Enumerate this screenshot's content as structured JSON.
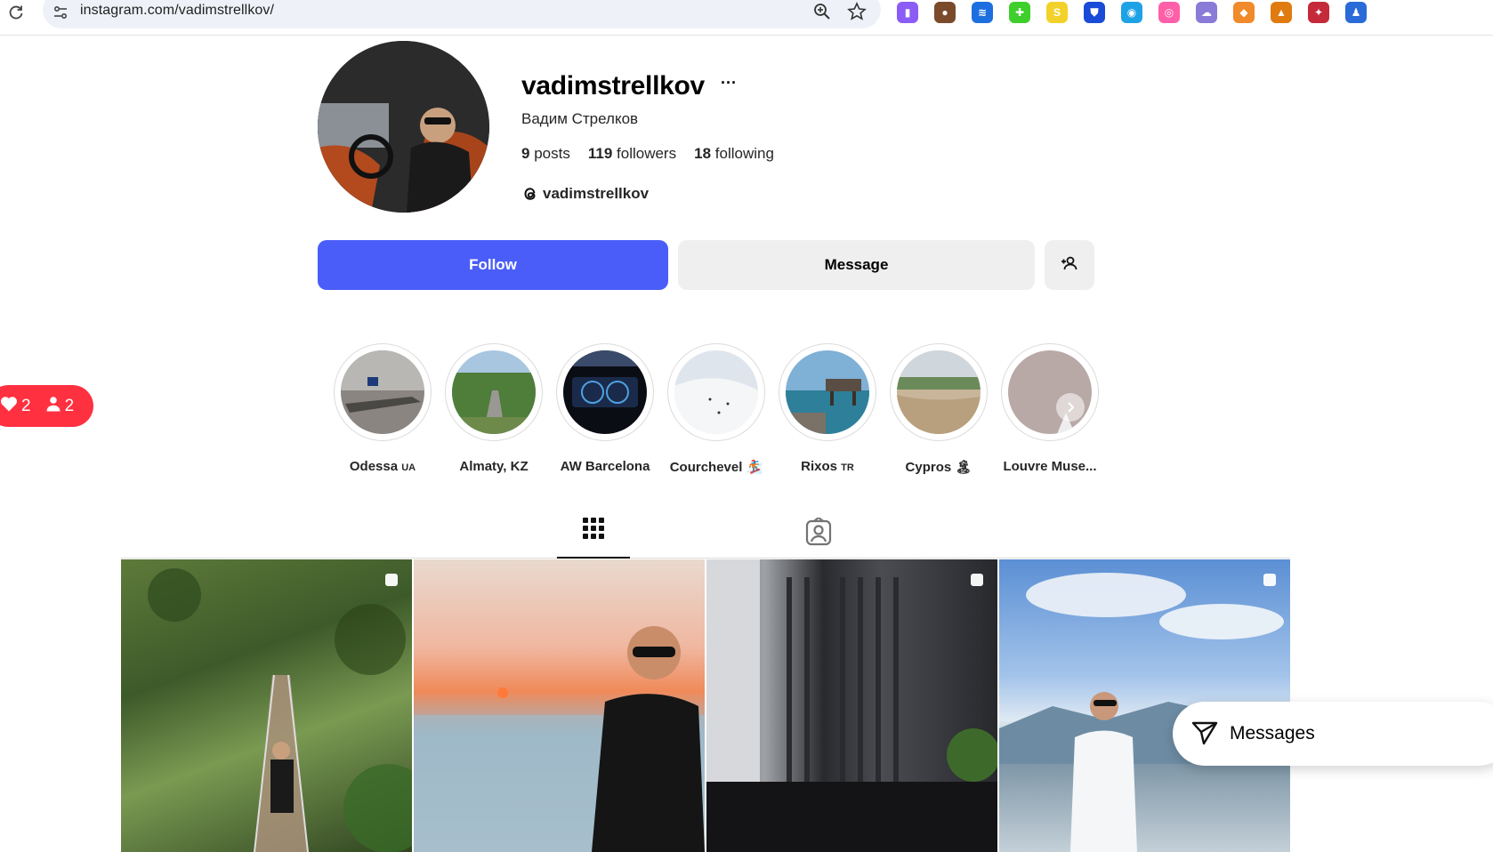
{
  "browser": {
    "url": "instagram.com/vadimstrellkov/",
    "extensions": [
      {
        "name": "purple-book-ext-icon",
        "color": "#8b5cf6",
        "glyph": "▮"
      },
      {
        "name": "cookie-ext-icon",
        "color": "#7a4a2a",
        "glyph": "●"
      },
      {
        "name": "layers-ext-icon",
        "color": "#1d6fe0",
        "glyph": "≋"
      },
      {
        "name": "green-grid-ext-icon",
        "color": "#3ecf2c",
        "glyph": "✚"
      },
      {
        "name": "yellow-s-ext-icon",
        "color": "#f2d22a",
        "glyph": "S"
      },
      {
        "name": "shield-ext-icon",
        "color": "#1a4bd8",
        "glyph": "⛊"
      },
      {
        "name": "blue-swirl-ext-icon",
        "color": "#1ea2e6",
        "glyph": "◉"
      },
      {
        "name": "pink-ext-icon",
        "color": "#ff5fa8",
        "glyph": "◎"
      },
      {
        "name": "purple-cloud-ext-icon",
        "color": "#8a7bd8",
        "glyph": "☁"
      },
      {
        "name": "fox-ext-icon",
        "color": "#f08a2a",
        "glyph": "◆"
      },
      {
        "name": "flame-ext-icon",
        "color": "#e07b10",
        "glyph": "▲"
      },
      {
        "name": "globe-ext-icon",
        "color": "#c52a3a",
        "glyph": "✦"
      },
      {
        "name": "puzzle-ext-icon",
        "color": "#2a6bd8",
        "glyph": "♟"
      }
    ]
  },
  "profile": {
    "username": "vadimstrellkov",
    "full_name": "Вадим Стрелков",
    "posts_count": "9",
    "posts_label": "posts",
    "followers_count": "119",
    "followers_label": "followers",
    "following_count": "18",
    "following_label": "following",
    "threads_handle": "vadimstrellkov"
  },
  "actions": {
    "follow_label": "Follow",
    "message_label": "Message"
  },
  "notifications": {
    "likes": "2",
    "follows": "2"
  },
  "highlights": [
    {
      "label": "Odessa",
      "flag": "UA"
    },
    {
      "label": "Almaty, KZ",
      "flag": ""
    },
    {
      "label": "AW Barcelona",
      "flag": ""
    },
    {
      "label": "Courchevel",
      "flag": "🏂"
    },
    {
      "label": "Rixos",
      "flag": "TR"
    },
    {
      "label": "Cypros",
      "flag": "🏝"
    },
    {
      "label": "Louvre Muse...",
      "flag": ""
    }
  ],
  "messages": {
    "label": "Messages"
  },
  "colors": {
    "follow_button": "#4a5df9",
    "notification": "#ff3040"
  }
}
